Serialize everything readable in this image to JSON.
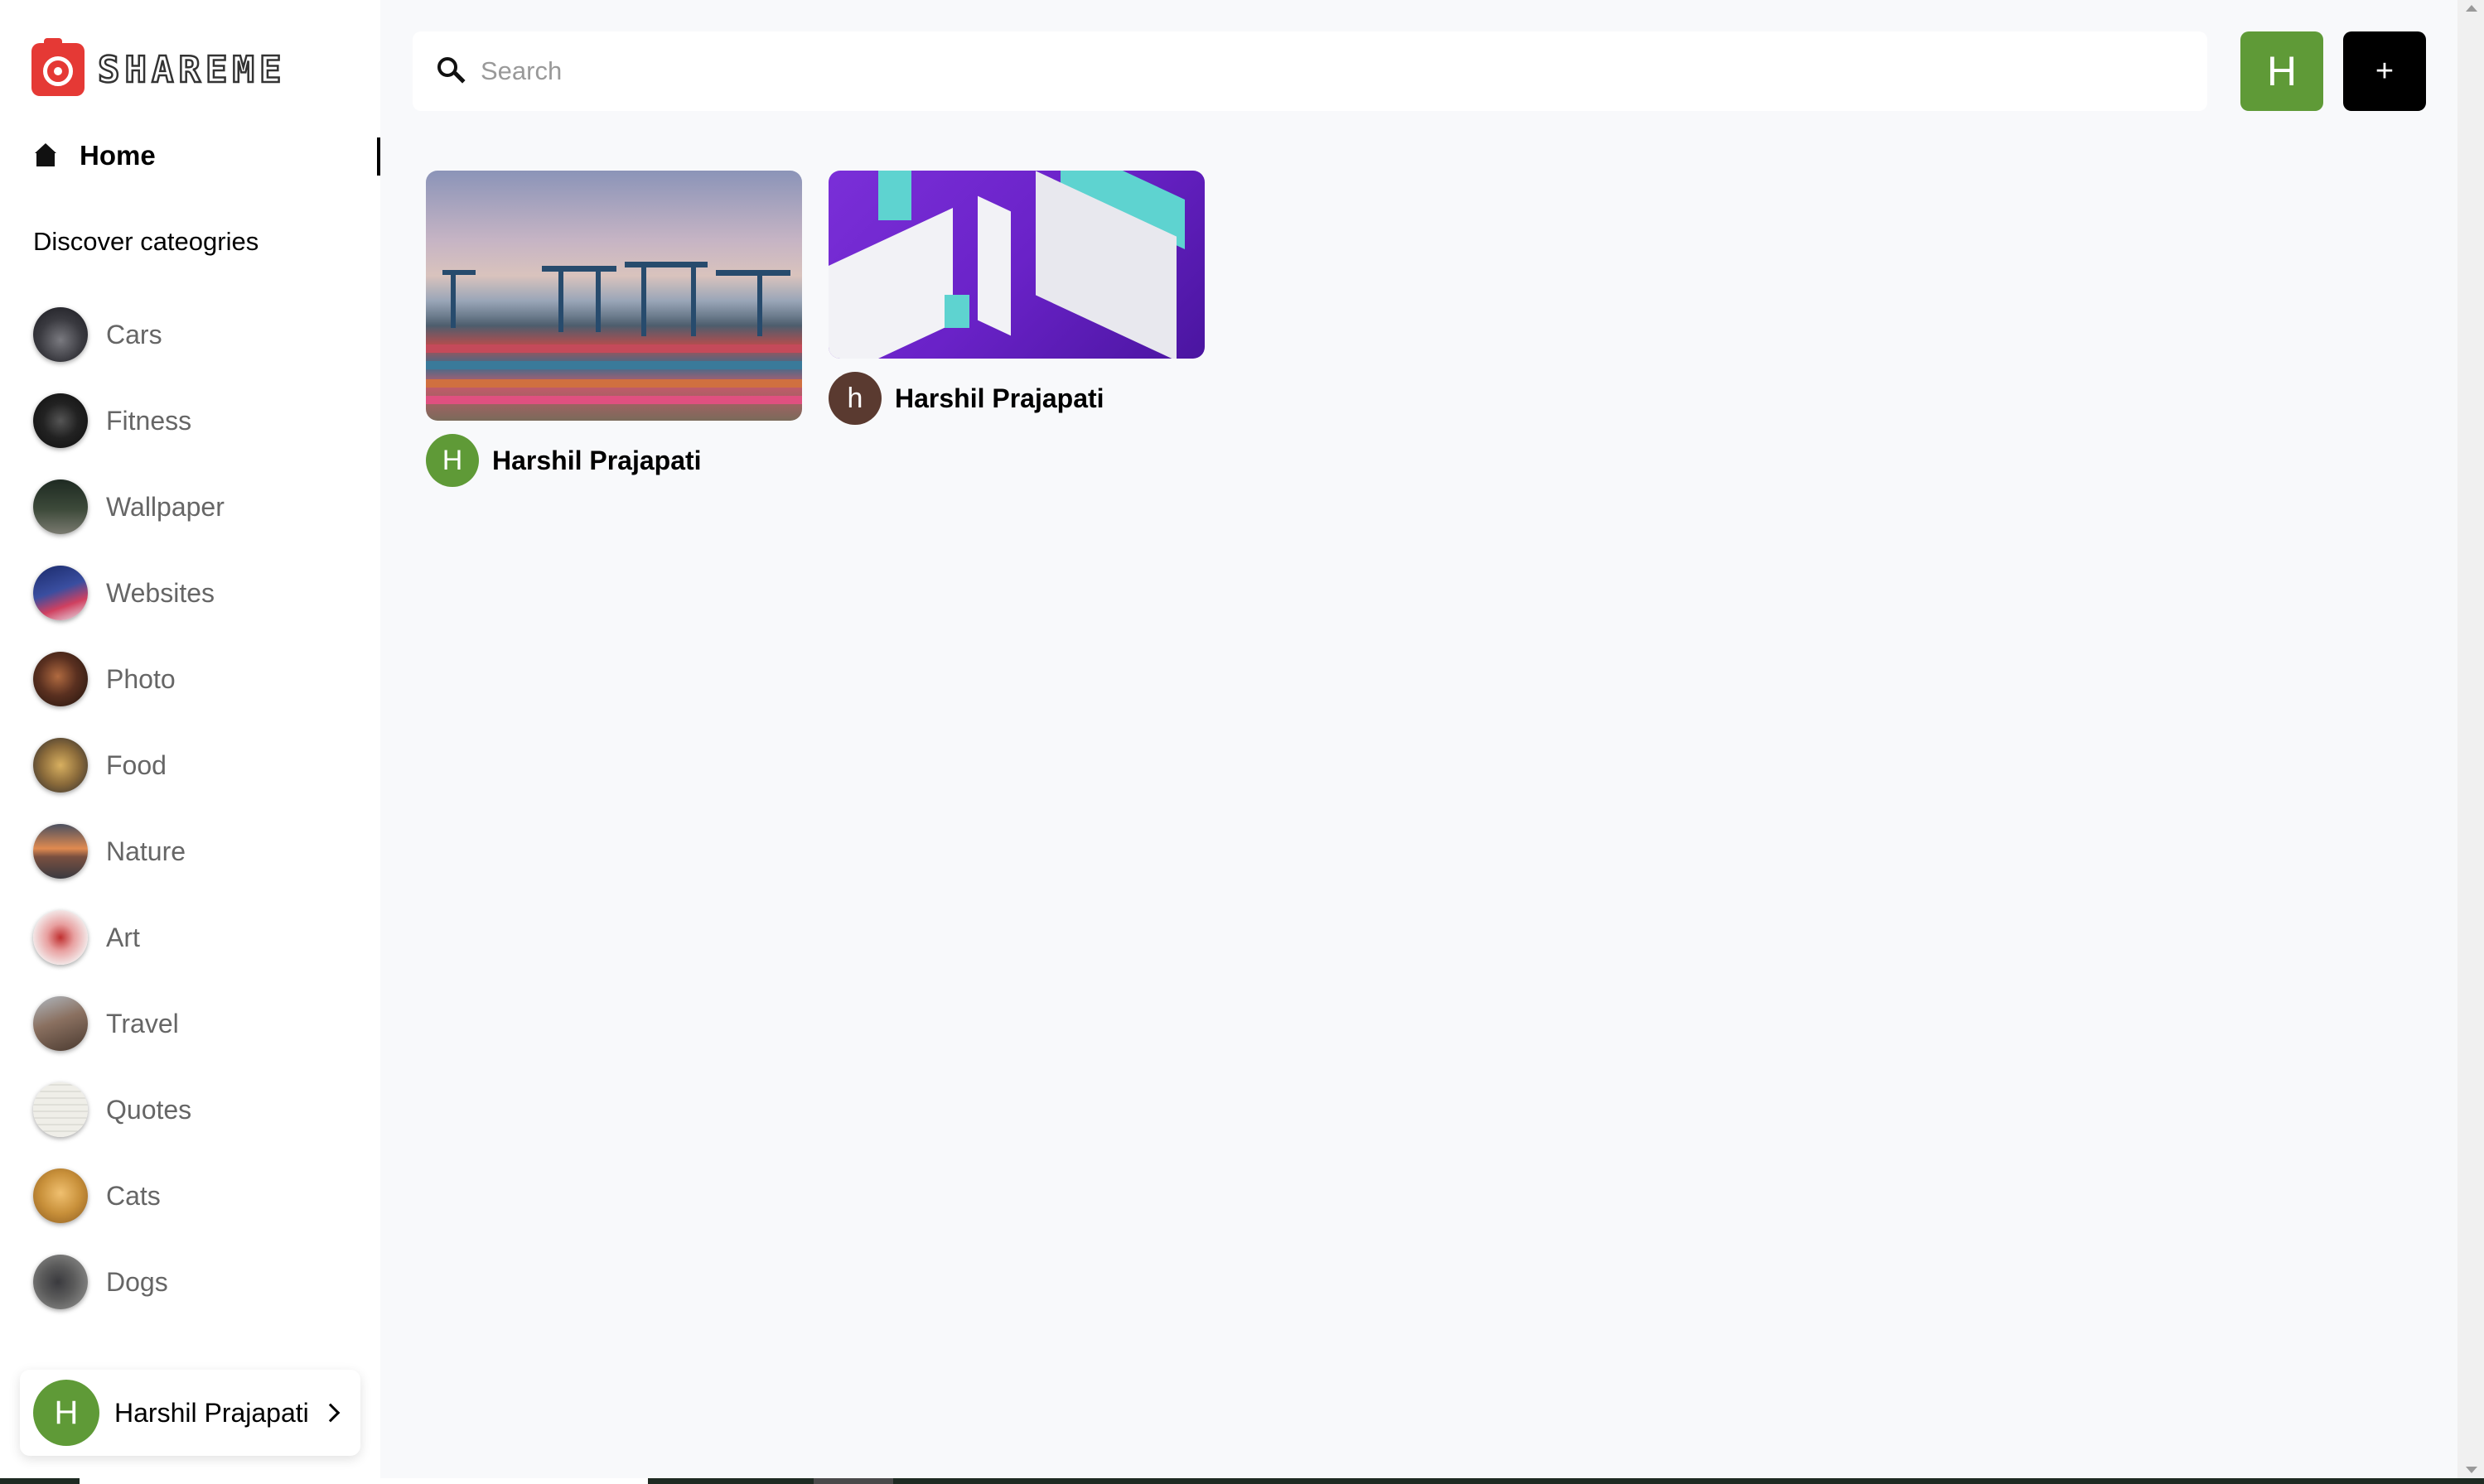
{
  "app": {
    "logo_text": "SHAREME"
  },
  "colors": {
    "brand_red": "#e53935",
    "avatar_green": "#5f9a37",
    "avatar_brown": "#5a3a30",
    "add_button": "#000000"
  },
  "sidebar": {
    "home_label": "Home",
    "discover_heading": "Discover cateogries",
    "categories": [
      {
        "label": "Cars",
        "icon": "cars-thumbnail",
        "color": "#4a4a50"
      },
      {
        "label": "Fitness",
        "icon": "fitness-thumbnail",
        "color": "#2a2a2a"
      },
      {
        "label": "Wallpaper",
        "icon": "wallpaper-thumbnail",
        "color": "#3d4a3a"
      },
      {
        "label": "Websites",
        "icon": "websites-thumbnail",
        "color": "#2c3e7a"
      },
      {
        "label": "Photo",
        "icon": "photo-thumbnail",
        "color": "#5a3020"
      },
      {
        "label": "Food",
        "icon": "food-thumbnail",
        "color": "#8a6a3a"
      },
      {
        "label": "Nature",
        "icon": "nature-thumbnail",
        "color": "#7a5040"
      },
      {
        "label": "Art",
        "icon": "art-thumbnail",
        "color": "#d8b0a8"
      },
      {
        "label": "Travel",
        "icon": "travel-thumbnail",
        "color": "#6a5a50"
      },
      {
        "label": "Quotes",
        "icon": "quotes-thumbnail",
        "color": "#ecebe5"
      },
      {
        "label": "Cats",
        "icon": "cats-thumbnail",
        "color": "#c8903a"
      },
      {
        "label": "Dogs",
        "icon": "dogs-thumbnail",
        "color": "#5a5a5a"
      }
    ],
    "user": {
      "initial": "H",
      "name": "Harshil Prajapati"
    }
  },
  "header": {
    "search": {
      "placeholder": "Search",
      "value": ""
    },
    "avatar_initial": "H",
    "add_label": "+"
  },
  "pins": [
    {
      "user_initial": "H",
      "user_name": "Harshil Prajapati",
      "image": "shipping-port-photo"
    },
    {
      "user_initial": "h",
      "user_name": "Harshil Prajapati",
      "image": "purple-isometric-illustration"
    }
  ]
}
